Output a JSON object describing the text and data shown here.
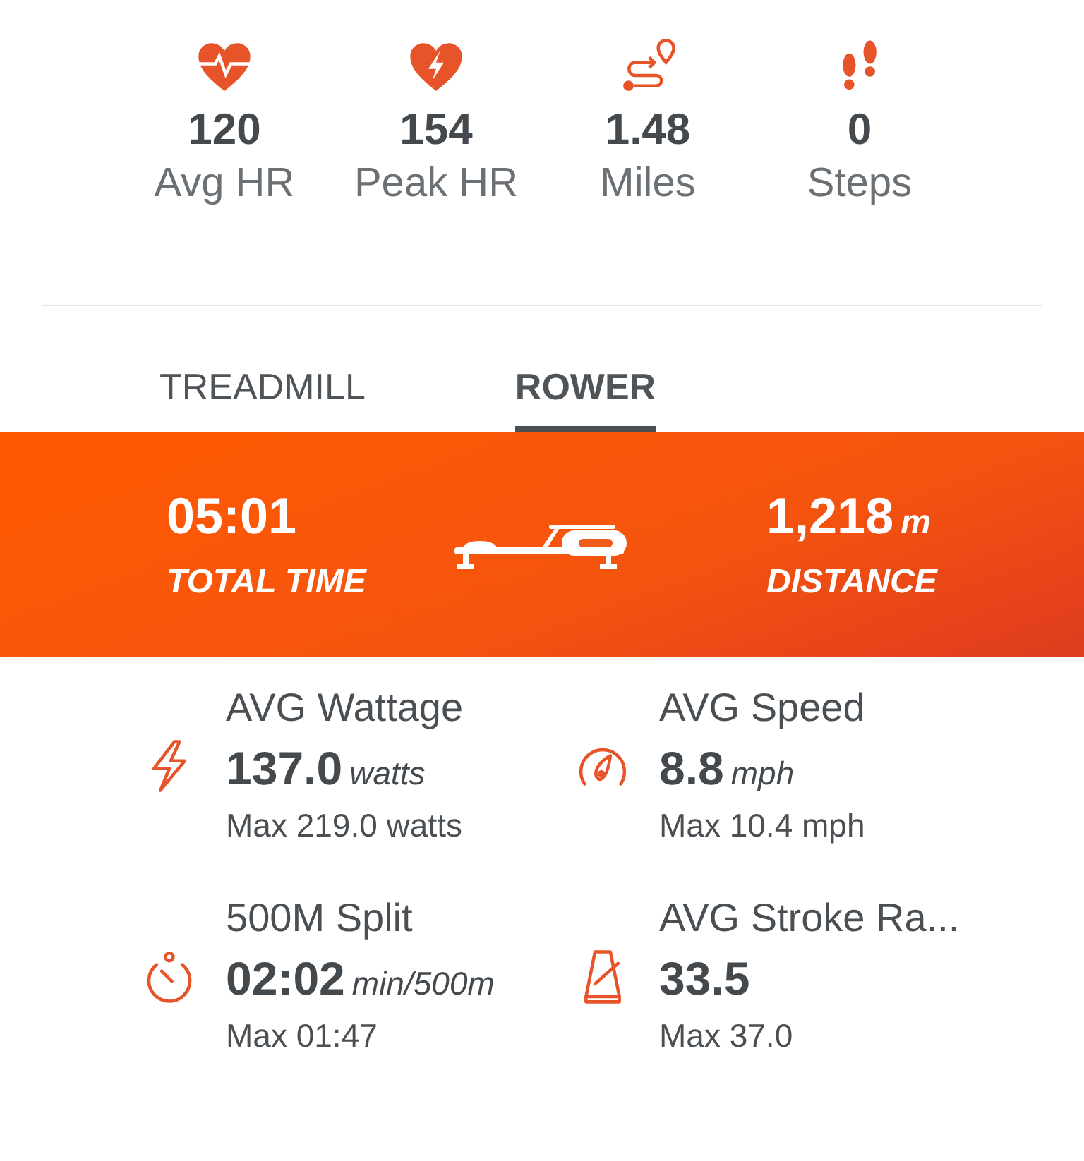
{
  "summary": [
    {
      "value": "120",
      "label": "Avg HR"
    },
    {
      "value": "154",
      "label": "Peak HR"
    },
    {
      "value": "1.48",
      "label": "Miles"
    },
    {
      "value": "0",
      "label": "Steps"
    }
  ],
  "tabs": [
    {
      "label": "TREADMILL",
      "selected": false
    },
    {
      "label": "ROWER",
      "selected": true
    }
  ],
  "banner": {
    "time": "05:01",
    "time_label": "TOTAL TIME",
    "distance": "1,218",
    "distance_unit": "m",
    "distance_label": "DISTANCE"
  },
  "metrics": [
    {
      "title": "AVG Wattage",
      "value": "137.0",
      "unit": "watts",
      "max": "Max 219.0 watts"
    },
    {
      "title": "AVG Speed",
      "value": "8.8",
      "unit": "mph",
      "max": "Max 10.4 mph"
    },
    {
      "title": "500M Split",
      "value": "02:02",
      "unit": "min/500m",
      "max": "Max 01:47"
    },
    {
      "title": "AVG Stroke Ra...",
      "value": "33.5",
      "max": "Max 37.0"
    }
  ]
}
